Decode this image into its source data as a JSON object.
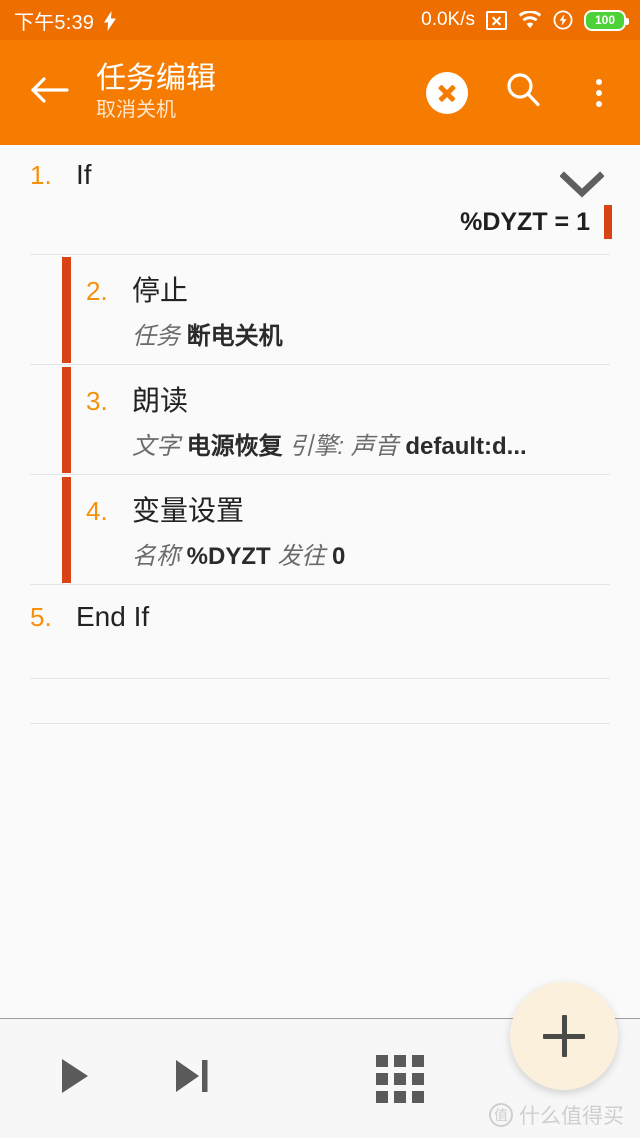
{
  "status_bar": {
    "clock": "下午5:39",
    "charging_icon": "bolt-icon",
    "net_speed": "0.0K/s",
    "no_sim_icon": "no-sim-icon",
    "wifi_icon": "wifi-icon",
    "flash_icon": "flash-circle-icon",
    "battery_level": "100",
    "battery_color": "#4CD137",
    "background": "#EE6E00"
  },
  "app_bar": {
    "back_icon": "arrow-left-icon",
    "title": "任务编辑",
    "subtitle": "取消关机",
    "close_icon": "close-circle-icon",
    "search_icon": "search-icon",
    "overflow_icon": "more-vertical-icon",
    "background": "#F57C00"
  },
  "accent": {
    "number_color": "#F5900A",
    "block_bar_color": "#D84315"
  },
  "actions": [
    {
      "number": "1.",
      "name": "If",
      "nested": false,
      "collapse_icon": "chevron-down-icon",
      "condition": "%DYZT = 1"
    },
    {
      "number": "2.",
      "name": "停止",
      "nested": true,
      "detail": [
        {
          "kind": "label",
          "text": "任务"
        },
        {
          "kind": "value",
          "text": "断电关机"
        }
      ]
    },
    {
      "number": "3.",
      "name": "朗读",
      "nested": true,
      "detail": [
        {
          "kind": "label",
          "text": "文字"
        },
        {
          "kind": "value",
          "text": "电源恢复"
        },
        {
          "kind": "label",
          "text": "引擎: 声音"
        },
        {
          "kind": "value",
          "text": "default:d..."
        }
      ]
    },
    {
      "number": "4.",
      "name": "变量设置",
      "nested": true,
      "detail": [
        {
          "kind": "label",
          "text": "名称"
        },
        {
          "kind": "value",
          "text": "%DYZT"
        },
        {
          "kind": "label",
          "text": "发往"
        },
        {
          "kind": "value",
          "text": "0"
        }
      ]
    },
    {
      "number": "5.",
      "name": "End If",
      "nested": false
    }
  ],
  "bottom_bar": {
    "play_icon": "play-icon",
    "step_icon": "skip-next-icon",
    "grid_icon": "grid-apps-icon"
  },
  "fab": {
    "add_icon": "plus-icon",
    "background": "#FBF0DC"
  },
  "watermark": {
    "logo_char": "值",
    "text": "什么值得买"
  }
}
